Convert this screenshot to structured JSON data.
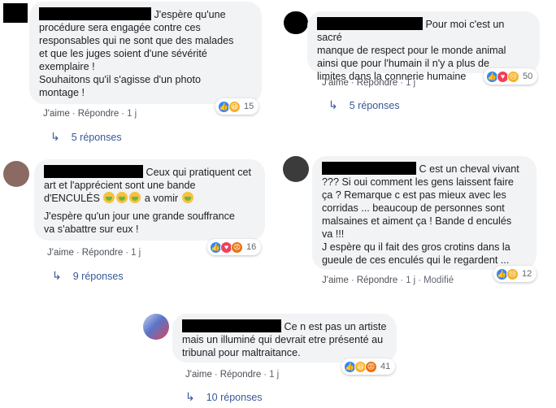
{
  "comments": [
    {
      "id": "c1",
      "text_lines": [
        "J'espère qu'une",
        "procédure sera engagée contre ces",
        "responsables qui ne sont que des malades",
        "et que les juges soient d'une sévérité",
        "exemplaire !",
        "Souhaitons qu'il s'agisse d'un photo",
        "montage !"
      ],
      "like_label": "J'aime",
      "reply_label": "Répondre",
      "time": "1 j",
      "reaction_count": "15",
      "reactions": [
        "like-icon",
        "haha-icon"
      ],
      "replies_label": "5 réponses"
    },
    {
      "id": "c2",
      "text_lines": [
        "Pour moi c'est un sacré",
        "manque de respect pour le monde animal",
        "ainsi que pour l'humain il n'y a plus de",
        "limites dans la connerie humaine"
      ],
      "like_label": "J'aime",
      "reply_label": "Répondre",
      "time": "1 j",
      "reaction_count": "50",
      "reactions": [
        "like-icon",
        "love-icon",
        "sad-icon"
      ],
      "replies_label": "5 réponses"
    },
    {
      "id": "c3",
      "text_lines": [
        "Ceux qui pratiquent cet",
        "art et l'apprécient sont une bande",
        "d'ENCULÉS",
        "a vomir"
      ],
      "text_lines_2": [
        "J'espère qu'un jour une grande souffrance",
        "va s'abattre sur eux !"
      ],
      "like_label": "J'aime",
      "reply_label": "Répondre",
      "time": "1 j",
      "reaction_count": "16",
      "reactions": [
        "like-icon",
        "love-icon",
        "angry-icon"
      ],
      "replies_label": "9 réponses"
    },
    {
      "id": "c4",
      "text_lines": [
        "C est un cheval vivant",
        "??? Si oui comment les gens laissent faire",
        "ça ? Remarque c est pas mieux avec les",
        "corridas ... beaucoup de personnes sont",
        "malsaines et aiment ça ! Bande d enculés",
        "va !!!",
        "J espère qu il fait des gros crotins dans la",
        "gueule de ces enculés qui le regardent ..."
      ],
      "like_label": "J'aime",
      "reply_label": "Répondre",
      "time": "1 j",
      "edited_label": "Modifié",
      "reaction_count": "12",
      "reactions": [
        "like-icon",
        "sad-icon"
      ]
    },
    {
      "id": "c5",
      "text_lines": [
        "Ce n est pas un artiste",
        "mais un illuminé qui devrait etre présenté au",
        "tribunal pour maltraitance."
      ],
      "like_label": "J'aime",
      "reply_label": "Répondre",
      "time": "1 j",
      "reaction_count": "41",
      "reactions": [
        "like-icon",
        "haha-icon",
        "angry-icon"
      ],
      "replies_label": "10 réponses"
    }
  ],
  "colors": {
    "bubble": "#f2f3f5",
    "link": "#385898",
    "meta": "#606770",
    "like": "#2d88ff",
    "love": "#f33e58",
    "angry": "#e9710f"
  }
}
